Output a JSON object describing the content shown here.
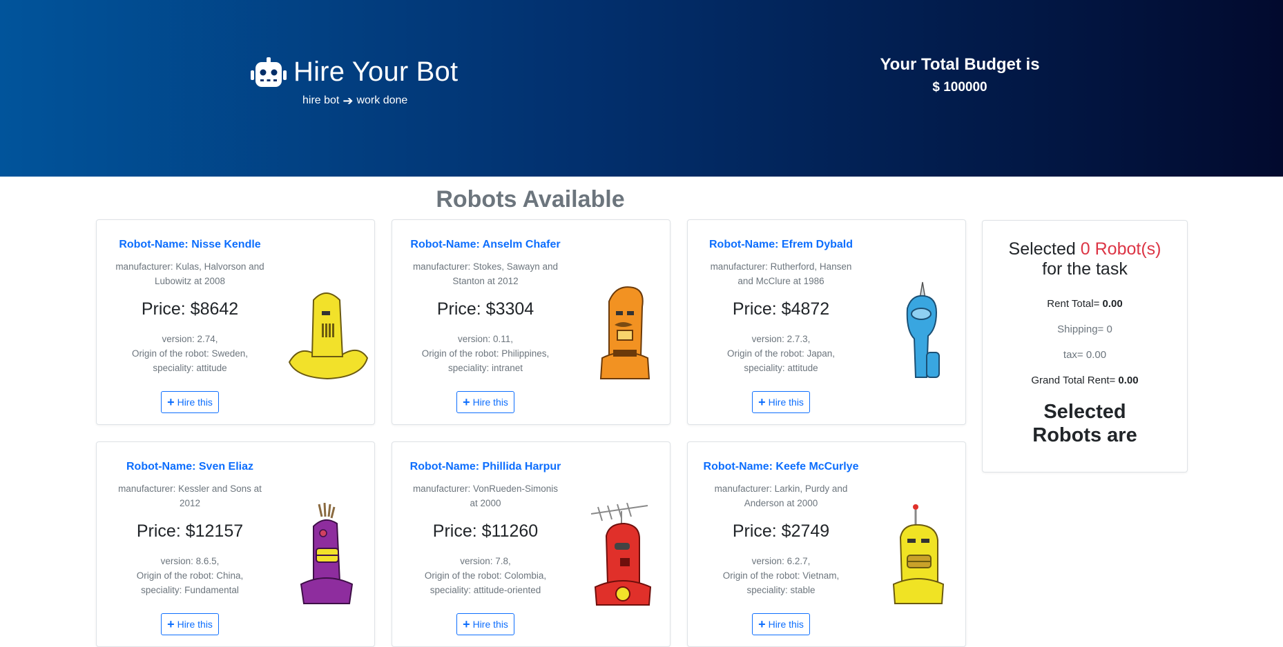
{
  "header": {
    "title": "Hire Your Bot",
    "tagline_left": "hire bot",
    "tagline_right": "work done",
    "budget_label": "Your Total Budget is",
    "budget_value": "$ 100000",
    "logo_icon": "robot-icon",
    "tag_arrow_icon": "arrow-right-icon"
  },
  "section_title": "Robots Available",
  "robots": [
    {
      "name": "Robot-Name: Nisse Kendle",
      "manufacturer": "manufacturer: Kulas, Halvorson and Lubowitz at 2008",
      "price": "Price: $8642",
      "version": "version: 2.74,",
      "origin": "Origin of the robot: Sweden,",
      "speciality": "speciality: attitude",
      "hire_label": "Hire this",
      "color": "#f2e12a",
      "shape": "yellow-banana-robot"
    },
    {
      "name": "Robot-Name: Anselm Chafer",
      "manufacturer": "manufacturer: Stokes, Sawayn and Stanton at 2012",
      "price": "Price: $3304",
      "version": "version: 0.11,",
      "origin": "Origin of the robot: Philippines,",
      "speciality": "speciality: intranet",
      "hire_label": "Hire this",
      "color": "#f29222",
      "shape": "orange-mustache-robot"
    },
    {
      "name": "Robot-Name: Efrem Dybald",
      "manufacturer": "manufacturer: Rutherford, Hansen and McClure at 1986",
      "price": "Price: $4872",
      "version": "version: 2.7.3,",
      "origin": "Origin of the robot: Japan,",
      "speciality": "speciality: attitude",
      "hire_label": "Hire this",
      "color": "#39a6e0",
      "shape": "blue-horn-robot"
    },
    {
      "name": "Robot-Name: Sven Eliaz",
      "manufacturer": "manufacturer: Kessler and Sons at 2012",
      "price": "Price: $12157",
      "version": "version: 8.6.5,",
      "origin": "Origin of the robot: China,",
      "speciality": "speciality: Fundamental",
      "hire_label": "Hire this",
      "color": "#8e2d9e",
      "shape": "purple-grin-robot"
    },
    {
      "name": "Robot-Name: Phillida Harpur",
      "manufacturer": "manufacturer: VonRueden-Simonis at 2000",
      "price": "Price: $11260",
      "version": "version: 7.8,",
      "origin": "Origin of the robot: Colombia,",
      "speciality": "speciality: attitude-oriented",
      "hire_label": "Hire this",
      "color": "#e0302a",
      "shape": "red-antenna-robot"
    },
    {
      "name": "Robot-Name: Keefe McCurlye",
      "manufacturer": "manufacturer: Larkin, Purdy and Anderson at 2000",
      "price": "Price: $2749",
      "version": "version: 6.2.7,",
      "origin": "Origin of the robot: Vietnam,",
      "speciality": "speciality: stable",
      "hire_label": "Hire this",
      "color": "#f0e324",
      "shape": "yellow-grin-robot"
    }
  ],
  "summary": {
    "selected_prefix": "Selected",
    "selected_count": "0 Robot(s)",
    "selected_suffix": "for the task",
    "rent_label": "Rent Total=",
    "rent_value": "0.00",
    "shipping": "Shipping= 0",
    "tax": "tax= 0.00",
    "grand_label": "Grand Total Rent=",
    "grand_value": "0.00",
    "robots_heading": "Selected Robots are"
  },
  "colors": {
    "accent": "#0d6efd",
    "danger": "#dc3545",
    "muted": "#6c757d",
    "header_start": "#01549b",
    "header_end": "#020a2e"
  }
}
